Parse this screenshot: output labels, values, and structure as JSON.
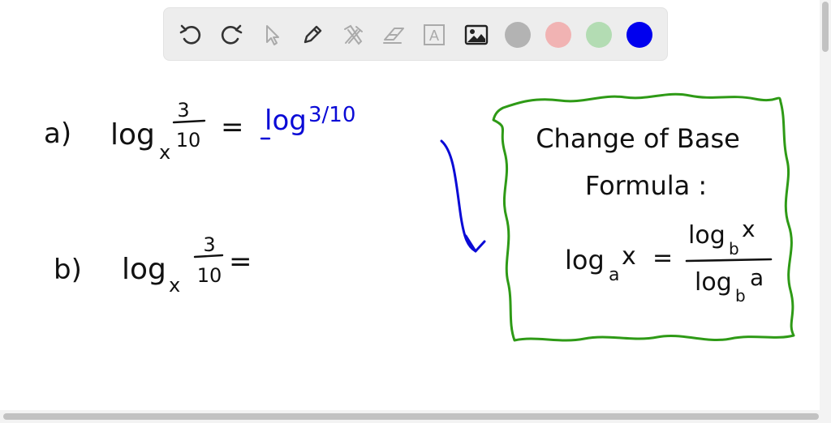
{
  "toolbar": {
    "tools": [
      {
        "icon": "undo-icon"
      },
      {
        "icon": "redo-icon"
      },
      {
        "icon": "select-pointer-icon"
      },
      {
        "icon": "pencil-icon"
      },
      {
        "icon": "tools-icon"
      },
      {
        "icon": "eraser-icon"
      },
      {
        "icon": "text-icon",
        "glyph": "A"
      },
      {
        "icon": "image-icon"
      }
    ],
    "colors": [
      "#b3b3b3",
      "#f1b3b3",
      "#b3dcb3",
      "#0000ee"
    ]
  },
  "canvas": {
    "problem_a": {
      "label": "a)",
      "log": "log",
      "base": "x",
      "num": "3",
      "den": "10",
      "equals": "=",
      "answer_log": "log",
      "answer_frac": "3/10"
    },
    "problem_b": {
      "label": "b)",
      "log": "log",
      "base": "x",
      "num": "3",
      "den": "10",
      "equals": "="
    },
    "formula_box": {
      "title_line1": "Change of Base",
      "title_line2": "Formula :",
      "lhs_log": "log",
      "lhs_base": "a",
      "lhs_arg": "x",
      "equals": "=",
      "num_log": "log",
      "num_base": "b",
      "num_arg": "x",
      "den_log": "log",
      "den_base": "b",
      "den_arg": "a"
    },
    "ink_colors": {
      "black": "#111111",
      "blue": "#0a0ad6",
      "green": "#2e9a16"
    }
  }
}
